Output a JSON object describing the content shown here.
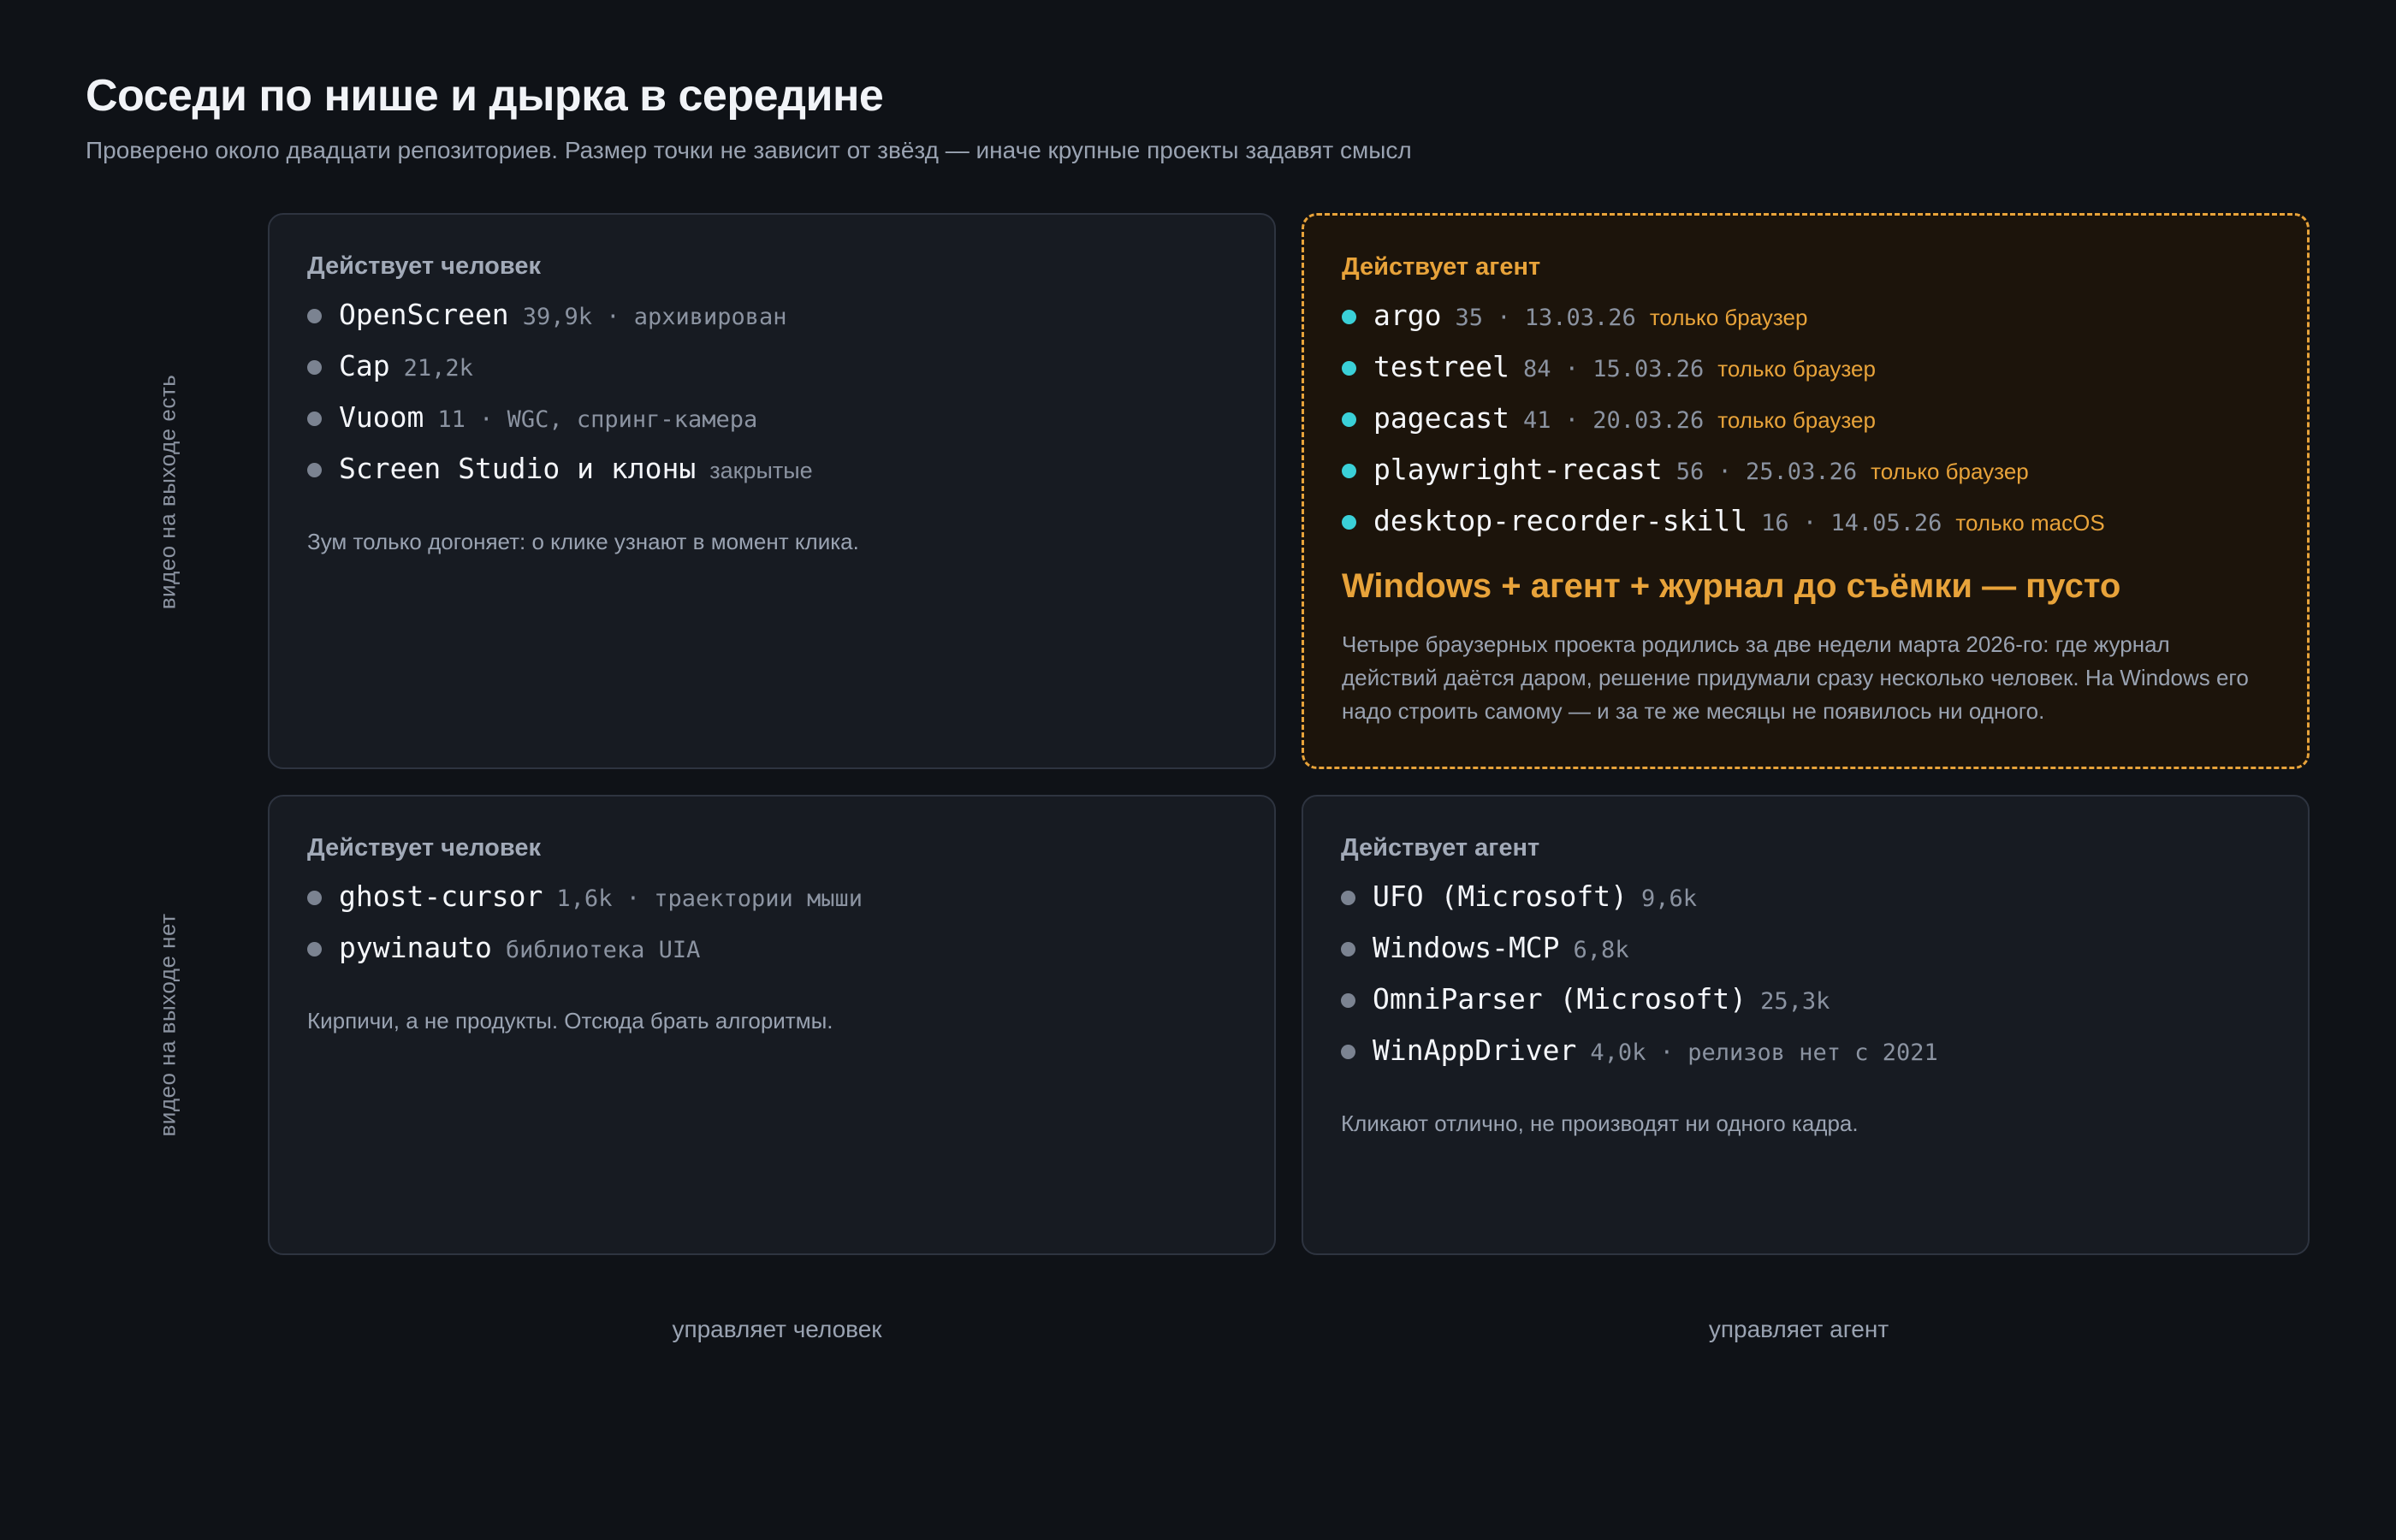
{
  "title": "Соседи по нише и дырка в середине",
  "subtitle": "Проверено около двадцати репозиториев. Размер точки не зависит от звёзд — иначе крупные проекты задавят смысл",
  "axes": {
    "y_top": "видео на выходе есть",
    "y_bottom": "видео на выходе нет",
    "x_left": "управляет человек",
    "x_right": "управляет агент"
  },
  "colors": {
    "background": "#0f1217",
    "panel": "#171b22",
    "accent": "#e8a33a",
    "agent_dot": "#3ad0d8",
    "neutral_dot": "#7b8391"
  },
  "quadrants": {
    "top_left": {
      "title": "Действует человек",
      "items": [
        {
          "name": "OpenScreen",
          "meta": "39,9k · архивирован"
        },
        {
          "name": "Cap",
          "meta": "21,2k"
        },
        {
          "name": "Vuoom",
          "meta": "11 · WGC, спринг-камера"
        },
        {
          "name": "Screen Studio и клоны",
          "meta": "закрытые"
        }
      ],
      "note": "Зум только догоняет: о клике узнают в момент клика."
    },
    "top_right": {
      "title": "Действует агент",
      "items": [
        {
          "name": "argo",
          "meta": "35 · 13.03.26",
          "tag": "только браузер"
        },
        {
          "name": "testreel",
          "meta": "84 · 15.03.26",
          "tag": "только браузер"
        },
        {
          "name": "pagecast",
          "meta": "41 · 20.03.26",
          "tag": "только браузер"
        },
        {
          "name": "playwright-recast",
          "meta": "56 · 25.03.26",
          "tag": "только браузер"
        },
        {
          "name": "desktop-recorder-skill",
          "meta": "16 · 14.05.26",
          "tag": "только macOS"
        }
      ],
      "callout": "Windows + агент + журнал до съёмки — пусто",
      "note": "Четыре браузерных проекта родились за две недели марта 2026-го: где журнал действий даётся даром, решение придумали сразу несколько человек. На Windows его надо строить самому — и за те же месяцы не появилось ни одного."
    },
    "bottom_left": {
      "title": "Действует человек",
      "items": [
        {
          "name": "ghost-cursor",
          "meta": "1,6k · траектории мыши"
        },
        {
          "name": "pywinauto",
          "meta": "библиотека UIA"
        }
      ],
      "note": "Кирпичи, а не продукты. Отсюда брать алгоритмы."
    },
    "bottom_right": {
      "title": "Действует агент",
      "items": [
        {
          "name": "UFO (Microsoft)",
          "meta": "9,6k"
        },
        {
          "name": "Windows-MCP",
          "meta": "6,8k"
        },
        {
          "name": "OmniParser (Microsoft)",
          "meta": "25,3k"
        },
        {
          "name": "WinAppDriver",
          "meta": "4,0k · релизов нет с 2021"
        }
      ],
      "note": "Кликают отлично, не производят ни одного кадра."
    }
  }
}
